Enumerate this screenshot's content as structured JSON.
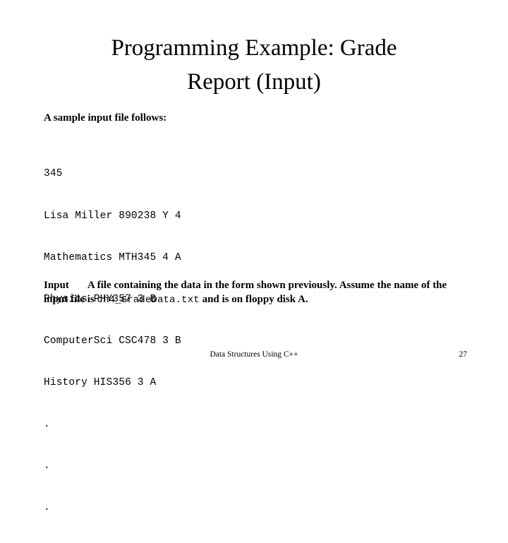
{
  "slide": {
    "title": {
      "line1": "Programming Example: Grade",
      "line2": "Report (Input)"
    },
    "intro": "A sample input file follows:",
    "data_listing": [
      "345",
      "Lisa Miller 890238 Y 4",
      "Mathematics MTH345 4 A",
      "Physics PHY357 3 B",
      "ComputerSci CSC478 3 B",
      "History HIS356 3 A",
      ".",
      ".",
      "."
    ],
    "input_section": {
      "label": "Input",
      "text_before": "A file containing the data in the form shown previously.  Assume the name of the input file is ",
      "filename": "ch4_GradeData.txt",
      "text_after": " and is on floppy disk A."
    },
    "footer": {
      "book_title": "Data Structures Using C++",
      "page_number": "27"
    },
    "colors": {
      "background": "#ffffff",
      "text": "#000000"
    }
  }
}
